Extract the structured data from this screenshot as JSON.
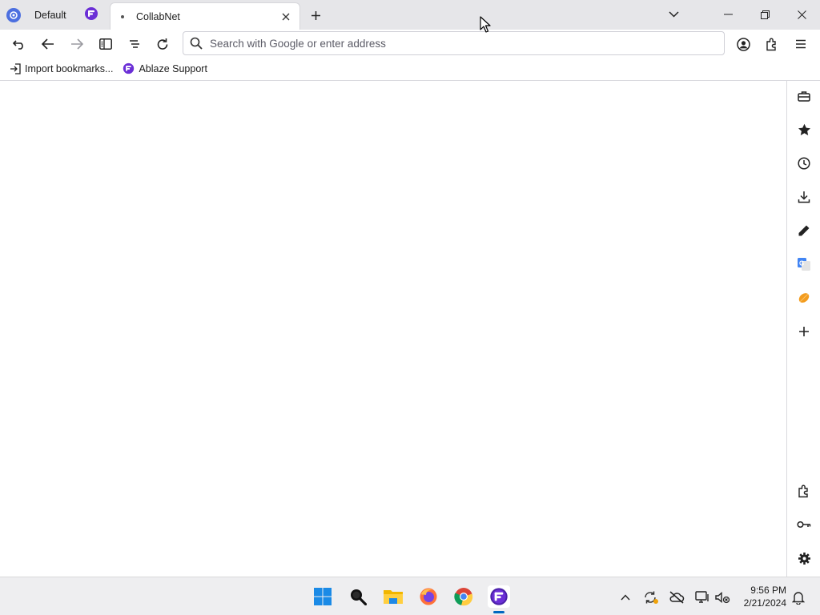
{
  "tabstrip": {
    "workspace_label": "Default",
    "tabs": [
      {
        "title": "CollabNet"
      }
    ]
  },
  "navbar": {
    "search_placeholder": "Search with Google or enter address"
  },
  "bookmarks": {
    "items": [
      {
        "label": "Import bookmarks...",
        "icon": "import-icon"
      },
      {
        "label": "Ablaze Support",
        "icon": "floorp-icon"
      }
    ]
  },
  "sidebar": {
    "icons": [
      "toolbox-icon",
      "star-icon",
      "history-icon",
      "download-icon",
      "pen-icon",
      "translate-icon",
      "orange-leaf-icon",
      "add-icon",
      "extensions-icon",
      "key-icon",
      "gear-icon"
    ]
  },
  "taskbar": {
    "apps": [
      "windows-start-icon",
      "search-icon",
      "file-explorer-icon",
      "firefox-icon",
      "chrome-icon",
      "floorp-icon"
    ],
    "time": "9:56 PM",
    "date": "2/21/2024"
  },
  "colors": {
    "tabstrip_bg": "#e6e6e9",
    "floorp_purple": "#6b2fd6",
    "taskbar_accent": "#0067c0"
  }
}
